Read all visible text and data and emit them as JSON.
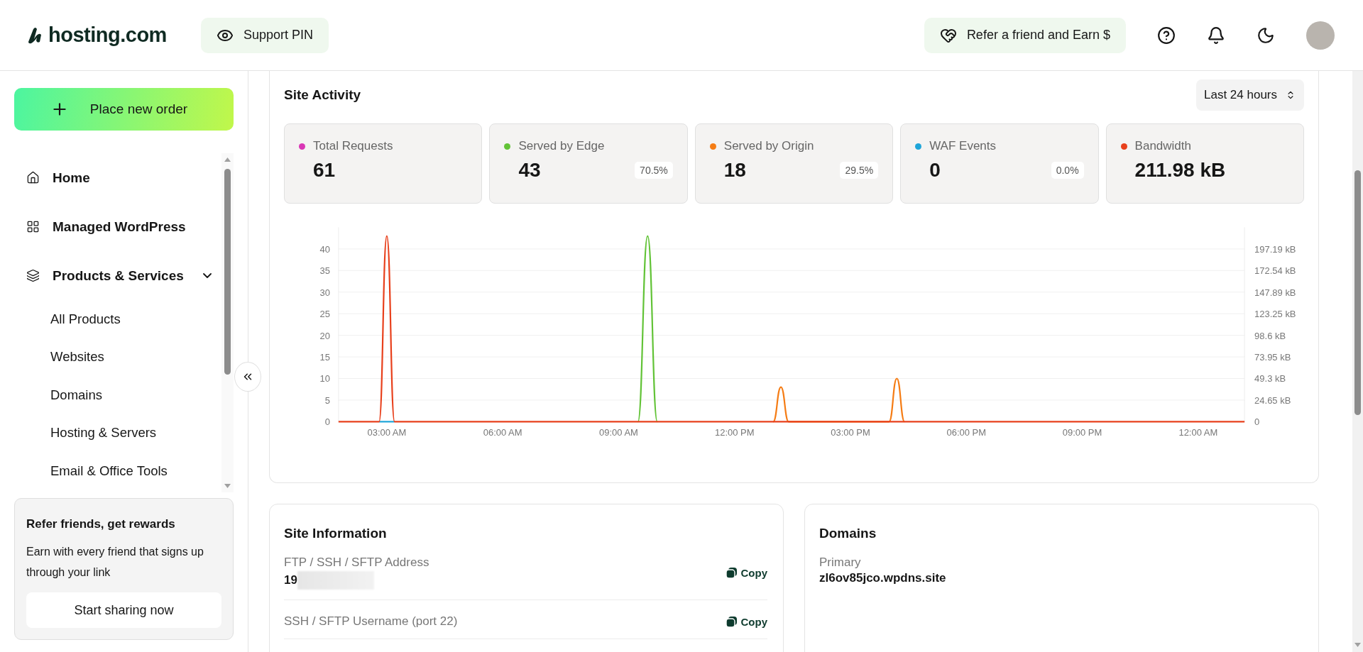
{
  "header": {
    "logo": "hosting.com",
    "support_button": "Support PIN",
    "refer_button": "Refer a friend and Earn $"
  },
  "sidebar": {
    "order_button": "Place new order",
    "items": [
      {
        "label": "Home"
      },
      {
        "label": "Managed WordPress"
      },
      {
        "label": "Products & Services",
        "expanded": true,
        "children": [
          {
            "label": "All Products"
          },
          {
            "label": "Websites"
          },
          {
            "label": "Domains"
          },
          {
            "label": "Hosting & Servers"
          },
          {
            "label": "Email & Office Tools"
          }
        ]
      }
    ],
    "promo": {
      "title": "Refer friends, get rewards",
      "text": "Earn with every friend that signs up through your link",
      "button": "Start sharing now"
    }
  },
  "site_activity": {
    "title": "Site Activity",
    "range": "Last 24 hours",
    "stats": [
      {
        "label": "Total Requests",
        "value": "61",
        "color": "#d936b5"
      },
      {
        "label": "Served by Edge",
        "value": "43",
        "share": "70.5%",
        "color": "#62c337"
      },
      {
        "label": "Served by Origin",
        "value": "18",
        "share": "29.5%",
        "color": "#f57c14"
      },
      {
        "label": "WAF Events",
        "value": "0",
        "share": "0.0%",
        "color": "#1ea5d9"
      },
      {
        "label": "Bandwidth",
        "value": "211.98 kB",
        "color": "#e8401c"
      }
    ],
    "chart_data": {
      "type": "line",
      "x": [
        1.75,
        2.8,
        3.0,
        3.2,
        9.5,
        9.75,
        10.0,
        13.0,
        13.2,
        13.4,
        16.0,
        16.2,
        16.4,
        25.2
      ],
      "series": [
        {
          "color": "#62c337",
          "axis": "y",
          "values": [
            null,
            null,
            null,
            null,
            0,
            43,
            0,
            null,
            null,
            null,
            null,
            null,
            null,
            null
          ]
        },
        {
          "color": "#f57c14",
          "axis": "y",
          "values": [
            null,
            null,
            null,
            null,
            null,
            null,
            null,
            0,
            8,
            0,
            0,
            10,
            0,
            null
          ]
        },
        {
          "color": "#1ea5d9",
          "axis": "y",
          "values": [
            null,
            0,
            0,
            0,
            null,
            null,
            null,
            null,
            null,
            null,
            null,
            null,
            null,
            null
          ]
        },
        {
          "color": "#e8401c",
          "axis": "y2",
          "values": [
            0,
            0,
            212,
            0,
            0,
            0,
            0,
            0,
            0,
            0,
            0,
            0,
            0,
            0
          ]
        }
      ],
      "xlim": [
        1.75,
        25.2
      ],
      "ylim": [
        0,
        45
      ],
      "y2lim": [
        0,
        221.84
      ],
      "grid": true,
      "xticks": [
        {
          "value": 3,
          "label": "03:00 AM"
        },
        {
          "value": 6,
          "label": "06:00 AM"
        },
        {
          "value": 9,
          "label": "09:00 AM"
        },
        {
          "value": 12,
          "label": "12:00 PM"
        },
        {
          "value": 15,
          "label": "03:00 PM"
        },
        {
          "value": 18,
          "label": "06:00 PM"
        },
        {
          "value": 21,
          "label": "09:00 PM"
        },
        {
          "value": 24,
          "label": "12:00 AM"
        }
      ],
      "yticks": [
        0,
        5,
        10,
        15,
        20,
        25,
        30,
        35,
        40
      ],
      "y2ticks": [
        {
          "value": 0,
          "label": "0"
        },
        {
          "value": 24.65,
          "label": "24.65 kB"
        },
        {
          "value": 49.3,
          "label": "49.3 kB"
        },
        {
          "value": 73.95,
          "label": "73.95 kB"
        },
        {
          "value": 98.6,
          "label": "98.6 kB"
        },
        {
          "value": 123.25,
          "label": "123.25 kB"
        },
        {
          "value": 147.89,
          "label": "147.89 kB"
        },
        {
          "value": 172.54,
          "label": "172.54 kB"
        },
        {
          "value": 197.19,
          "label": "197.19 kB"
        }
      ]
    }
  },
  "site_information": {
    "title": "Site Information",
    "rows": [
      {
        "label": "FTP / SSH / SFTP Address",
        "value": "19",
        "redacted": true,
        "action": "Copy"
      },
      {
        "label": "SSH / SFTP Username (port 22)",
        "action": "Copy"
      }
    ]
  },
  "domains": {
    "title": "Domains",
    "label": "Primary",
    "value": "zl6ov85jco.wpdns.site"
  }
}
